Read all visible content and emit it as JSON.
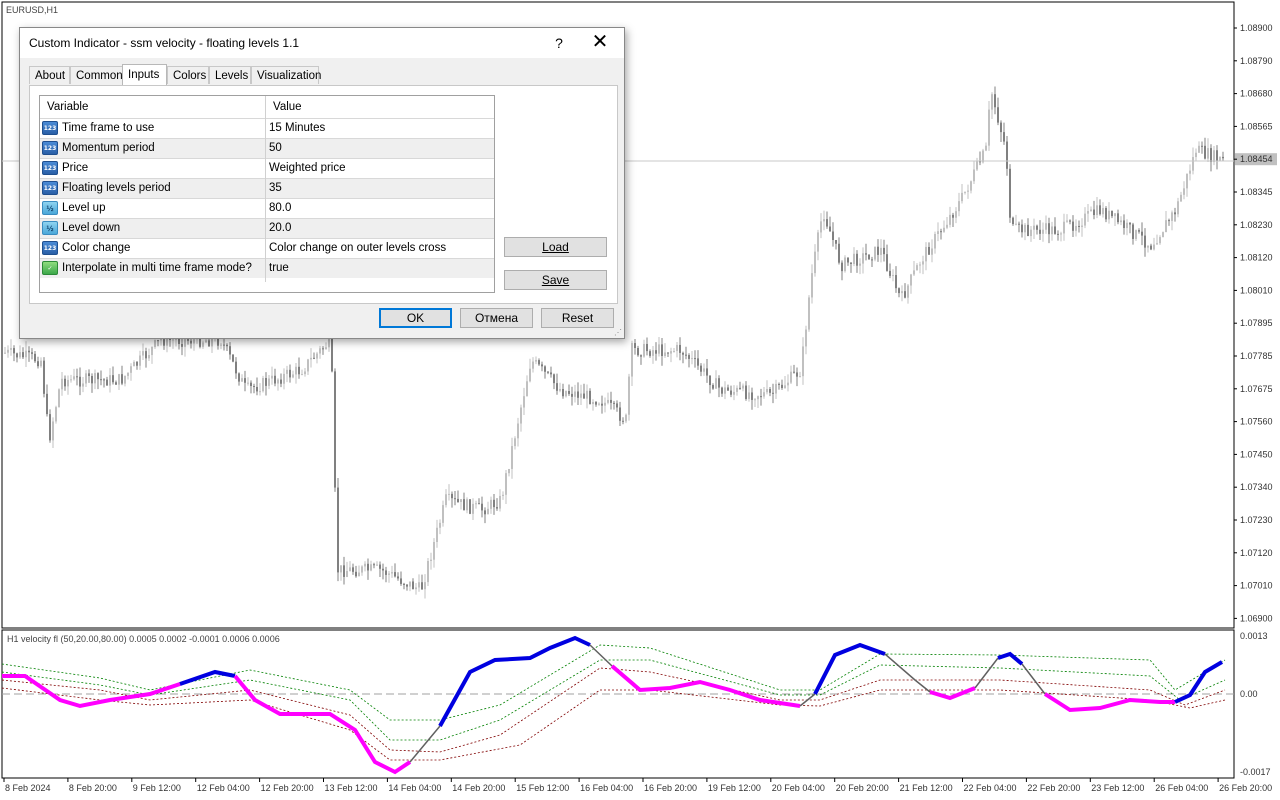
{
  "chart": {
    "symbol_label": "EURUSD,H1",
    "indicator_label": "H1 velocity fl (50,20.00,80.00) 0.0005 0.0002 -0.0001 0.0006 0.0006",
    "price_axis": [
      "1.08900",
      "1.08790",
      "1.08680",
      "1.08565",
      "1.08454",
      "1.08345",
      "1.08230",
      "1.08120",
      "1.08010",
      "1.07895",
      "1.07785",
      "1.07675",
      "1.07560",
      "1.07450",
      "1.07340",
      "1.07230",
      "1.07120",
      "1.07010",
      "1.06900"
    ],
    "current_price": "1.08454",
    "indicator_axis": [
      "0.0013",
      "0.00",
      "-0.0017"
    ],
    "time_axis": [
      "8 Feb 2024",
      "8 Feb 20:00",
      "9 Feb 12:00",
      "12 Feb 04:00",
      "12 Feb 20:00",
      "13 Feb 12:00",
      "14 Feb 04:00",
      "14 Feb 20:00",
      "15 Feb 12:00",
      "16 Feb 04:00",
      "16 Feb 20:00",
      "19 Feb 12:00",
      "20 Feb 04:00",
      "20 Feb 20:00",
      "21 Feb 12:00",
      "22 Feb 04:00",
      "22 Feb 20:00",
      "23 Feb 12:00",
      "26 Feb 04:00",
      "26 Feb 20:00"
    ],
    "colors": {
      "bull_candle": "#c0c0c0",
      "bear_candle": "#808080",
      "velocity_up": "#0000e0",
      "velocity_down": "#ff00ff",
      "velocity_neutral": "#606060",
      "level_up": "#008000",
      "level_down": "#800000",
      "zero_line": "#a0a0a0"
    }
  },
  "dialog": {
    "title": "Custom Indicator - ssm velocity - floating levels 1.1",
    "help": "?",
    "close": "✕",
    "tabs": [
      "About",
      "Common",
      "Inputs",
      "Colors",
      "Levels",
      "Visualization"
    ],
    "active_tab": "Inputs",
    "grid": {
      "col_variable": "Variable",
      "col_value": "Value",
      "rows": [
        {
          "icon": "123",
          "type": "num",
          "name": "Time frame to use",
          "value": "15 Minutes"
        },
        {
          "icon": "123",
          "type": "num",
          "name": "Momentum period",
          "value": "50"
        },
        {
          "icon": "123",
          "type": "num",
          "name": "Price",
          "value": "Weighted price"
        },
        {
          "icon": "123",
          "type": "num",
          "name": "Floating levels period",
          "value": "35"
        },
        {
          "icon": "½",
          "type": "dbl",
          "name": "Level up",
          "value": "80.0"
        },
        {
          "icon": "½",
          "type": "dbl",
          "name": "Level down",
          "value": "20.0"
        },
        {
          "icon": "123",
          "type": "num",
          "name": "Color change",
          "value": "Color change on outer levels cross"
        },
        {
          "icon": "✓",
          "type": "bool",
          "name": "Interpolate in multi time frame mode?",
          "value": "true"
        }
      ]
    },
    "buttons": {
      "load": "Load",
      "save": "Save",
      "ok": "OK",
      "cancel": "Отмена",
      "reset": "Reset"
    }
  }
}
